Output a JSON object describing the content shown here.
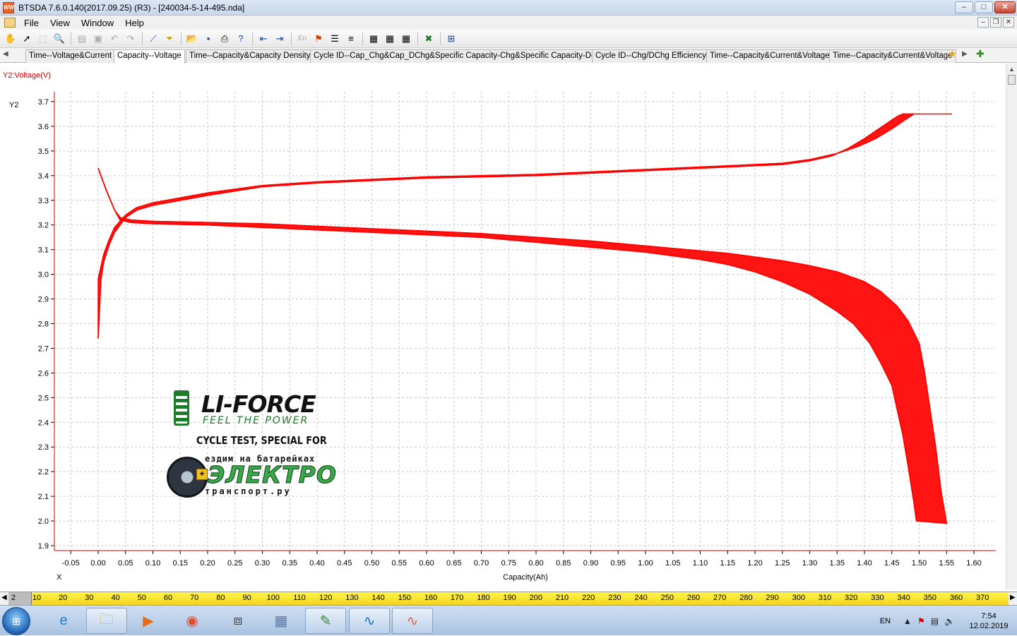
{
  "window": {
    "title": "BTSDA 7.6.0.140(2017.09.25) (R3) - [240034-5-14-495.nda]",
    "app_icon": "battery-tester-icon",
    "controls": {
      "minimize": "–",
      "maximize": "□",
      "close": "✕"
    }
  },
  "menu": {
    "items": [
      "File",
      "View",
      "Window",
      "Help"
    ],
    "mdi_controls": {
      "minimize": "–",
      "restore": "❐",
      "close": "✕"
    }
  },
  "toolbar": {
    "icons": [
      "pan-icon",
      "pointer-icon",
      "zoom-rect-icon",
      "zoom-icon",
      "grid-icon",
      "layout-icon",
      "undo-icon",
      "redo-icon",
      "cursor-line-icon",
      "filter-icon",
      "open-icon",
      "save-icon",
      "print-icon",
      "help-icon",
      "back-icon",
      "forward-icon",
      "language-icon",
      "marker-icon",
      "list-icon",
      "list2-icon",
      "table-icon",
      "table2-icon",
      "table3-icon",
      "excel-icon",
      "report-icon"
    ]
  },
  "tabs": [
    {
      "label": "Time--Voltage&Current",
      "active": false
    },
    {
      "label": "Capacity--Voltage",
      "active": true
    },
    {
      "label": "Time--Capacity&Capacity Density",
      "active": false
    },
    {
      "label": "Cycle ID--Cap_Chg&Cap_DChg&Specific Capacity-Chg&Specific Capacity-Dchg",
      "active": false
    },
    {
      "label": "Cycle ID--Chg/DChg Efficiency",
      "active": false
    },
    {
      "label": "Time--Capacity&Current&Voltage",
      "active": false
    },
    {
      "label": "Time--Capacity&Current&Voltage",
      "active": false
    }
  ],
  "chart_data": {
    "type": "line",
    "y2_axis_title": "Y2:Voltage(V)",
    "y_axis_label": "Y2",
    "x_axis_label": "X",
    "xlabel": "Capacity(Ah)",
    "xlim": [
      -0.08,
      1.64
    ],
    "ylim": [
      1.88,
      3.74
    ],
    "x_ticks": [
      -0.05,
      0,
      0.05,
      0.1,
      0.15,
      0.2,
      0.25,
      0.3,
      0.35,
      0.4,
      0.45,
      0.5,
      0.55,
      0.6,
      0.65,
      0.7,
      0.75,
      0.8,
      0.85,
      0.9,
      0.95,
      1.0,
      1.05,
      1.1,
      1.15,
      1.2,
      1.25,
      1.3,
      1.35,
      1.4,
      1.45,
      1.5,
      1.55,
      1.6
    ],
    "y_ticks": [
      1.9,
      2.0,
      2.1,
      2.2,
      2.3,
      2.4,
      2.5,
      2.6,
      2.7,
      2.8,
      2.9,
      3.0,
      3.1,
      3.2,
      3.3,
      3.4,
      3.5,
      3.6,
      3.7
    ],
    "grid": true,
    "color": "#ff0000",
    "series": [
      {
        "x": [
          0,
          0.005,
          0.01,
          0.02,
          0.03,
          0.05,
          0.07,
          0.1,
          0.15,
          0.2,
          0.3,
          0.4,
          0.5,
          0.6,
          0.7,
          0.8,
          0.9,
          1.0,
          1.1,
          1.2,
          1.25,
          1.3,
          1.34,
          1.37,
          1.4,
          1.42,
          1.44,
          1.46,
          1.47
        ],
        "y": [
          2.74,
          2.98,
          3.05,
          3.12,
          3.17,
          3.23,
          3.26,
          3.28,
          3.3,
          3.32,
          3.355,
          3.37,
          3.38,
          3.39,
          3.395,
          3.4,
          3.41,
          3.42,
          3.43,
          3.44,
          3.445,
          3.46,
          3.48,
          3.51,
          3.55,
          3.58,
          3.61,
          3.64,
          3.65
        ]
      },
      {
        "x": [
          0,
          0.005,
          0.01,
          0.02,
          0.03,
          0.05,
          0.07,
          0.1,
          0.15,
          0.2,
          0.3,
          0.4,
          0.5,
          0.6,
          0.7,
          0.8,
          0.9,
          1.0,
          1.1,
          1.2,
          1.25,
          1.3,
          1.35,
          1.39,
          1.42,
          1.45,
          1.47,
          1.49
        ],
        "y": [
          2.98,
          3.03,
          3.08,
          3.14,
          3.19,
          3.24,
          3.27,
          3.29,
          3.31,
          3.33,
          3.36,
          3.375,
          3.385,
          3.395,
          3.4,
          3.405,
          3.415,
          3.425,
          3.435,
          3.445,
          3.45,
          3.465,
          3.49,
          3.52,
          3.55,
          3.59,
          3.62,
          3.65
        ]
      },
      {
        "x": [
          1.47,
          1.56
        ],
        "y": [
          3.65,
          3.65
        ]
      },
      {
        "x": [
          0,
          0.015,
          0.03,
          0.04,
          0.06,
          0.1,
          0.2,
          0.3,
          0.4,
          0.5,
          0.6,
          0.7,
          0.8,
          0.9,
          1.0,
          1.1,
          1.15,
          1.2,
          1.25,
          1.3,
          1.35,
          1.38,
          1.41,
          1.43,
          1.45,
          1.46,
          1.47,
          1.48,
          1.49,
          1.495
        ],
        "y": [
          3.43,
          3.34,
          3.26,
          3.22,
          3.21,
          3.205,
          3.2,
          3.19,
          3.18,
          3.17,
          3.16,
          3.15,
          3.13,
          3.11,
          3.09,
          3.06,
          3.04,
          3.01,
          2.97,
          2.92,
          2.85,
          2.8,
          2.72,
          2.64,
          2.55,
          2.45,
          2.35,
          2.22,
          2.08,
          2.0
        ]
      },
      {
        "x": [
          0,
          0.015,
          0.03,
          0.04,
          0.06,
          0.1,
          0.2,
          0.3,
          0.4,
          0.5,
          0.6,
          0.7,
          0.8,
          0.9,
          1.0,
          1.1,
          1.15,
          1.2,
          1.25,
          1.3,
          1.35,
          1.4,
          1.43,
          1.46,
          1.48,
          1.5,
          1.51,
          1.52,
          1.53,
          1.54,
          1.55
        ],
        "y": [
          3.43,
          3.34,
          3.26,
          3.23,
          3.22,
          3.215,
          3.21,
          3.205,
          3.195,
          3.185,
          3.175,
          3.165,
          3.15,
          3.135,
          3.115,
          3.095,
          3.085,
          3.07,
          3.055,
          3.035,
          3.01,
          2.97,
          2.93,
          2.87,
          2.81,
          2.72,
          2.6,
          2.45,
          2.3,
          2.12,
          1.99
        ]
      }
    ]
  },
  "watermark": {
    "brand": "LI-FORCE",
    "slogan": "FEEL THE POWER",
    "caption": "CYCLE TEST, SPECIAL FOR",
    "partner_top": "ездим на батарейках",
    "partner_main": "ЭЛЕКТРО",
    "partner_bottom": "транспорт.ру"
  },
  "cycle_ruler": {
    "current": "2",
    "ticks": [
      "10",
      "20",
      "30",
      "40",
      "50",
      "60",
      "70",
      "80",
      "90",
      "100",
      "110",
      "120",
      "130",
      "140",
      "150",
      "160",
      "170",
      "180",
      "190",
      "200",
      "210",
      "220",
      "230",
      "240",
      "250",
      "260",
      "270",
      "280",
      "290",
      "300",
      "310",
      "320",
      "330",
      "340",
      "350",
      "360",
      "370"
    ]
  },
  "taskbar": {
    "apps": [
      {
        "name": "ie-icon",
        "glyph": "e",
        "open": false
      },
      {
        "name": "explorer-icon",
        "glyph": "🗀",
        "open": true
      },
      {
        "name": "media-player-icon",
        "glyph": "▶",
        "open": false
      },
      {
        "name": "chrome-icon",
        "glyph": "◉",
        "open": false
      },
      {
        "name": "package-icon",
        "glyph": "⧈",
        "open": false
      },
      {
        "name": "calculator-icon",
        "glyph": "▦",
        "open": false
      },
      {
        "name": "paint-icon",
        "glyph": "✎",
        "open": true
      },
      {
        "name": "bts-monitor-icon",
        "glyph": "∿",
        "open": true
      },
      {
        "name": "btsda-icon",
        "glyph": "∿",
        "open": true
      }
    ],
    "tray": {
      "lang": "EN",
      "time": "7:54",
      "date": "12.02.2019"
    }
  }
}
